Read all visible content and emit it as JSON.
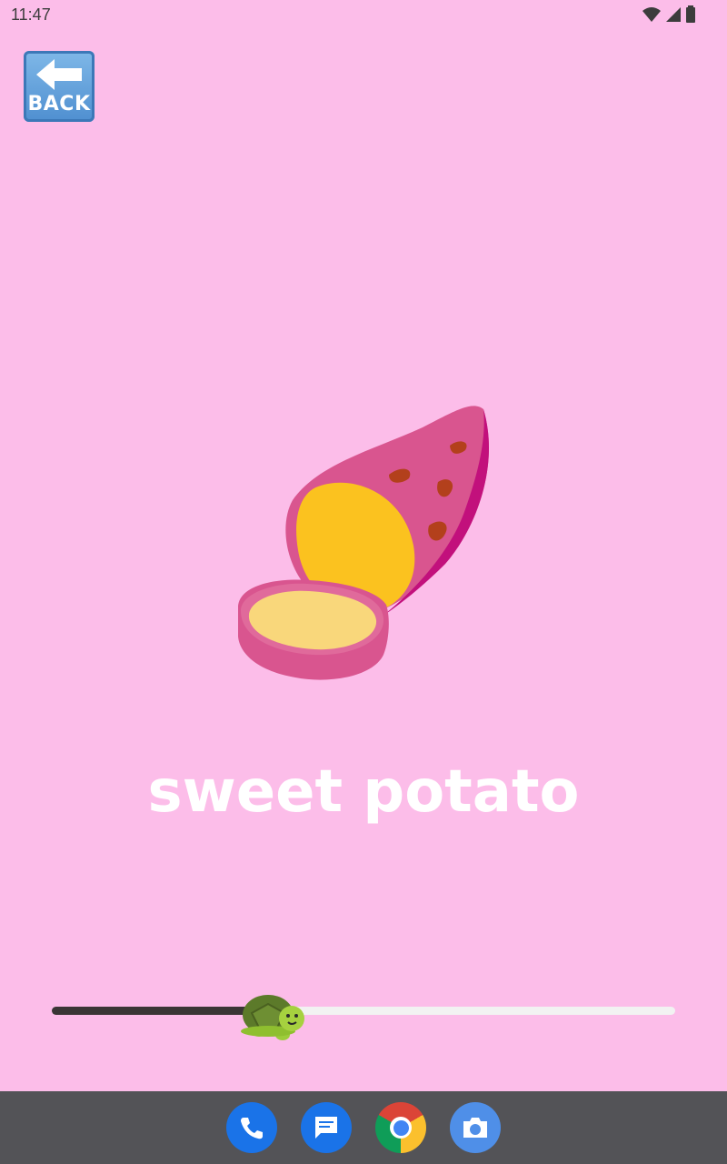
{
  "status_bar": {
    "time": "11:47",
    "icons": [
      "wifi-icon",
      "cell-signal-icon",
      "battery-icon"
    ]
  },
  "back_button": {
    "label": "BACK",
    "icon": "back-arrow-icon"
  },
  "card": {
    "image": "sweet-potato-icon",
    "word": "sweet potato",
    "background": "#fcbde9"
  },
  "slider": {
    "value": 0.35,
    "thumb_icon": "turtle-icon"
  },
  "dock": {
    "apps": [
      "phone-app-icon",
      "messages-app-icon",
      "chrome-app-icon",
      "camera-app-icon"
    ]
  }
}
